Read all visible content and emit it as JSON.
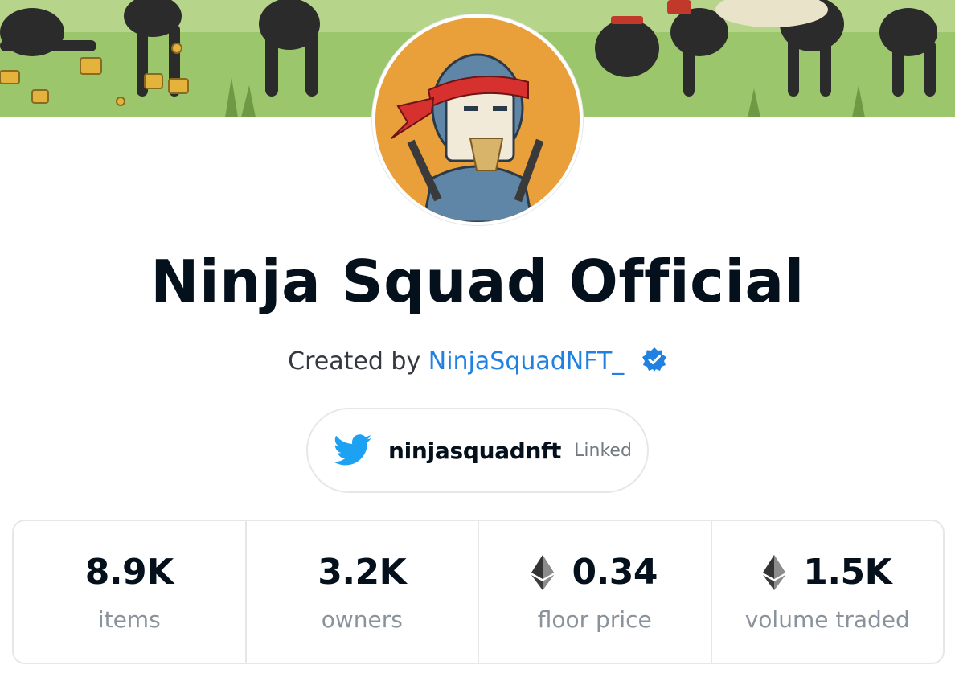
{
  "collection": {
    "title": "Ninja Squad Official",
    "created_by_prefix": "Created by",
    "creator_name": "NinjaSquadNFT_",
    "verified_icon": "verified-badge-icon"
  },
  "social": {
    "icon": "twitter-icon",
    "handle": "ninjasquadnft",
    "status": "Linked"
  },
  "stats": [
    {
      "value": "8.9K",
      "label": "items",
      "currency_icon": null
    },
    {
      "value": "3.2K",
      "label": "owners",
      "currency_icon": null
    },
    {
      "value": "0.34",
      "label": "floor price",
      "currency_icon": "ethereum-icon"
    },
    {
      "value": "1.5K",
      "label": "volume traded",
      "currency_icon": "ethereum-icon"
    }
  ],
  "colors": {
    "link": "#2081e2",
    "twitter": "#1da1f2",
    "avatar_bg": "#e9a03a",
    "banner_grass": "#9cc66c"
  }
}
